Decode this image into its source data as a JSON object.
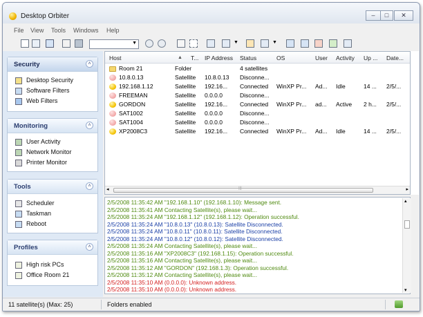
{
  "window": {
    "title": "Desktop Orbiter"
  },
  "menu": [
    "File",
    "View",
    "Tools",
    "Windows",
    "Help"
  ],
  "sidebar": {
    "panels": [
      {
        "title": "Security",
        "items": [
          "Desktop Security",
          "Software Filters",
          "Web Filters"
        ]
      },
      {
        "title": "Monitoring",
        "items": [
          "User Activity",
          "Network Monitor",
          "Printer Monitor"
        ]
      },
      {
        "title": "Tools",
        "items": [
          "Scheduler",
          "Taskman",
          "Reboot"
        ]
      },
      {
        "title": "Profiles",
        "items": [
          "High risk PCs",
          "Office Room 21"
        ]
      }
    ]
  },
  "hosts": {
    "columns": [
      "Host",
      "T...",
      "IP Address",
      "Status",
      "OS",
      "User",
      "Activity",
      "Up ...",
      "Date..."
    ],
    "sort_indicator": "▲",
    "rows": [
      {
        "icon": "folder",
        "host": "Room 21",
        "type": "Folder",
        "ip": "",
        "status": "4 satellites",
        "os": "",
        "user": "",
        "activity": "",
        "up": "",
        "date": ""
      },
      {
        "icon": "sat-off",
        "host": "10.8.0.13",
        "type": "Satellite",
        "ip": "10.8.0.13",
        "status": "Disconne...",
        "os": "",
        "user": "",
        "activity": "",
        "up": "",
        "date": ""
      },
      {
        "icon": "sat-on",
        "host": "192.168.1.12",
        "type": "Satellite",
        "ip": "192.16...",
        "status": "Connected",
        "os": "WinXP Pr...",
        "user": "Ad...",
        "activity": "Idle",
        "up": "14 ...",
        "date": "2/5/..."
      },
      {
        "icon": "sat-off",
        "host": "FREEMAN",
        "type": "Satellite",
        "ip": "0.0.0.0",
        "status": "Disconne...",
        "os": "",
        "user": "",
        "activity": "",
        "up": "",
        "date": ""
      },
      {
        "icon": "sat-on",
        "host": "GORDON",
        "type": "Satellite",
        "ip": "192.16...",
        "status": "Connected",
        "os": "WinXP Pr...",
        "user": "ad...",
        "activity": "Active",
        "up": "2 h...",
        "date": "2/5/..."
      },
      {
        "icon": "sat-off",
        "host": "SAT1002",
        "type": "Satellite",
        "ip": "0.0.0.0",
        "status": "Disconne...",
        "os": "",
        "user": "",
        "activity": "",
        "up": "",
        "date": ""
      },
      {
        "icon": "sat-off",
        "host": "SAT1004",
        "type": "Satellite",
        "ip": "0.0.0.0",
        "status": "Disconne...",
        "os": "",
        "user": "",
        "activity": "",
        "up": "",
        "date": ""
      },
      {
        "icon": "sat-on",
        "host": "XP2008C3",
        "type": "Satellite",
        "ip": "192.16...",
        "status": "Connected",
        "os": "WinXP Pr...",
        "user": "Ad...",
        "activity": "Idle",
        "up": "14 ...",
        "date": "2/5/..."
      }
    ]
  },
  "log": {
    "colors": {
      "ok": "#4f8a10",
      "info": "#1a3fa6",
      "error": "#d42020"
    },
    "lines": [
      {
        "level": "ok",
        "text": "2/5/2008 11:35:42 AM  \"192.168.1.10\" (192.168.1.10): Message sent."
      },
      {
        "level": "ok",
        "text": "2/5/2008 11:35:41 AM  Contacting Satellite(s), please wait..."
      },
      {
        "level": "ok",
        "text": "2/5/2008 11:35:24 AM  \"192.168.1.12\" (192.168.1.12): Operation successful."
      },
      {
        "level": "info",
        "text": "2/5/2008 11:35:24 AM  \"10.8.0.13\" (10.8.0.13): Satellite Disconnected."
      },
      {
        "level": "info",
        "text": "2/5/2008 11:35:24 AM  \"10.8.0.11\" (10.8.0.11): Satellite Disconnected."
      },
      {
        "level": "info",
        "text": "2/5/2008 11:35:24 AM  \"10.8.0.12\" (10.8.0.12): Satellite Disconnected."
      },
      {
        "level": "ok",
        "text": "2/5/2008 11:35:24 AM  Contacting Satellite(s), please wait..."
      },
      {
        "level": "ok",
        "text": "2/5/2008 11:35:16 AM  \"XP2008C3\" (192.168.1.15): Operation successful."
      },
      {
        "level": "ok",
        "text": "2/5/2008 11:35:16 AM  Contacting Satellite(s), please wait..."
      },
      {
        "level": "ok",
        "text": "2/5/2008 11:35:12 AM  \"GORDON\" (192.168.1.3): Operation successful."
      },
      {
        "level": "ok",
        "text": "2/5/2008 11:35:12 AM  Contacting Satellite(s), please wait..."
      },
      {
        "level": "error",
        "text": "2/5/2008 11:35:10 AM  (0.0.0.0): Unknown address."
      },
      {
        "level": "error",
        "text": "2/5/2008 11:35:10 AM  (0.0.0.0): Unknown address."
      }
    ]
  },
  "status": {
    "satellites": "11 satellite(s) (Max: 25)",
    "folders": "Folders enabled"
  }
}
